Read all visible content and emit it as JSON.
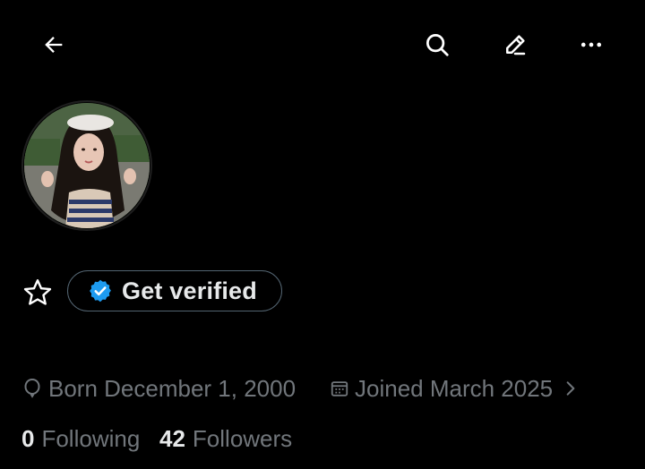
{
  "header": {
    "back_icon": "arrow-left-icon",
    "search_icon": "search-icon",
    "edit_icon": "pencil-icon",
    "more_icon": "more-horizontal-icon"
  },
  "profile": {
    "avatar_icon": "profile-photo",
    "highlight_icon": "star-outline-icon",
    "get_verified_label": "Get verified",
    "verified_badge_color": "#1d9bf0",
    "born_label": "Born December 1, 2000",
    "joined_label": "Joined March 2025",
    "following_count": "0",
    "following_label": "Following",
    "followers_count": "42",
    "followers_label": "Followers"
  }
}
